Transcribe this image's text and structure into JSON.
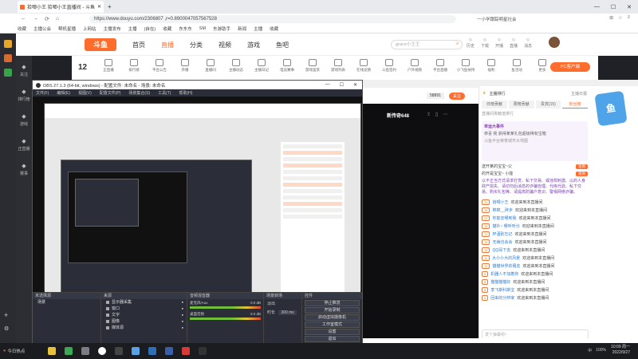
{
  "browser": {
    "tab_title": "拾唧小王 拾唧小王直播间 - 斗鱼",
    "url": "https://www.douyu.com/2306807 ,r=0.8900047057567528",
    "address_right_label": "一小学跟踪明星社会",
    "bookmarks": [
      "收藏",
      "主播公会",
      "帮机星播",
      "上网站",
      "主播发布",
      "主播",
      "(自在)",
      "收藏",
      "东东东",
      "SM",
      "东游助手",
      "新闻",
      "主播",
      "收藏"
    ]
  },
  "leftnav": {
    "items": [
      {
        "label": "关注",
        "icon": "heart-icon"
      },
      {
        "label": "排行榜",
        "icon": "rank-icon"
      },
      {
        "label": "游戏",
        "icon": "game-icon"
      },
      {
        "label": "正直播",
        "icon": "live-icon"
      },
      {
        "label": "赛事",
        "icon": "trophy-icon"
      }
    ]
  },
  "douyu": {
    "logo": "斗鱼",
    "nav": [
      "首页",
      "直播",
      "分类",
      "视频",
      "游戏",
      "鱼吧"
    ],
    "nav_active": "直播",
    "search_placeholder": "grace小王王",
    "top_icons": [
      "历史",
      "下载",
      "开播",
      "直播",
      "消息"
    ]
  },
  "categories": {
    "count": "12",
    "items": [
      "正直播",
      "排行榜",
      "平台公告",
      "开播",
      "直播间",
      "主播动态",
      "主播日记",
      "电竞赛事",
      "游戏鉴赏",
      "游戏列表",
      "在线竞猜",
      "斗鱼签约",
      "户外视频",
      "平台直播",
      "小飞鱼扶持",
      "福利",
      "鱼活动",
      "更多"
    ],
    "pc_button": "PC客户端"
  },
  "stream": {
    "banner": "新传奇648",
    "follow_count": "58891",
    "follow_button": "关注"
  },
  "chat": {
    "host_label": "主播排行",
    "host_right": "主播日报",
    "tabs": [
      "日榜贡献",
      "周榜贡献",
      "贵宾(15)",
      "粉丝榜"
    ],
    "active_tab": "粉丝榜",
    "rank_note": "直播间贡献值排行",
    "sys_title": "幸运大事件",
    "sys_line": "恭喜 我 获得某某礼包超级稀有宝箱",
    "sys_sub": "斗鱼平台荣誉城市大地图",
    "fans": [
      {
        "name": "送开某的宝宝~父",
        "badge": "签到"
      },
      {
        "name": "的开是宝宝~ 小能",
        "badge": "签到"
      }
    ],
    "warning": "以不正当方式请求打赏、私下交易、或违规刺激、以的人身财产损失、请切勿后消息的诈骗自理、代练代验、私下交易、购买礼包等、请提高防骗户意识、警惕网络诈骗。",
    "messages": [
      {
        "lv": "31",
        "name": "拾唧小王",
        "text": "欢迎来到本直播间"
      },
      {
        "lv": "26",
        "name": "棉棉__碎步",
        "text": "欢迎来到本直播间"
      },
      {
        "lv": "22",
        "name": "你能去哪到我",
        "text": "欢迎来到本直播间"
      },
      {
        "lv": "18",
        "name": "猫扑~ 哪听听分",
        "text": "欢迎来到本直播间"
      },
      {
        "lv": "17",
        "name": "杯酒别忘记",
        "text": "欢迎来到本直播间"
      },
      {
        "lv": "15",
        "name": "无病也会会",
        "text": "欢迎来到本直播间"
      },
      {
        "lv": "12",
        "name": "QQ哥下去",
        "text": "欢迎来到本直播间"
      },
      {
        "lv": "11",
        "name": "大小小大的风景",
        "text": "欢迎来到本直播间"
      },
      {
        "lv": "10",
        "name": "猫猫世界的朋友",
        "text": "欢迎来到本直播间"
      },
      {
        "lv": "9",
        "name": "机器人不加着你",
        "text": "欢迎来到本直播间"
      },
      {
        "lv": "8",
        "name": "猫猫猫猫好",
        "text": "欢迎来到本直播间"
      },
      {
        "lv": "6",
        "name": "李飞斯科斯宝",
        "text": "欢迎来到本直播间"
      },
      {
        "lv": "5",
        "name": "回来的分辨家",
        "text": "欢迎来到本直播间"
      }
    ],
    "input_placeholder": "发个弹幕呗~"
  },
  "obs": {
    "title": "OBS 27.1.3 (64-bit, windows) - 配置文件: 未命名 - 场景: 未命名",
    "menu": [
      "文件(F)",
      "编辑(E)",
      "视图(V)",
      "配置文件(P)",
      "场景集合(S)",
      "工具(T)",
      "帮助(H)"
    ],
    "docks": {
      "scenes": "场景",
      "sources": "来源",
      "mixer": "音频混音器",
      "transitions": "场景转场",
      "controls": "控件"
    },
    "scenes_header": "未选择源",
    "sources": [
      "显示器采集",
      "窗口",
      "文字",
      "图像",
      "媒体源"
    ],
    "mixer": [
      {
        "name": "麦克风/Aux",
        "level": "0.0 dB"
      },
      {
        "name": "桌面音频",
        "level": "0.0 dB"
      }
    ],
    "transition": {
      "type": "淡出",
      "duration_label": "时长",
      "duration": "300 ms"
    },
    "controls": [
      "停止推流",
      "开始录制",
      "启动虚拟摄像机",
      "工作室模式",
      "设置",
      "退出"
    ]
  },
  "taskbar": {
    "start_label": "今日热点",
    "time": "10:09 周一",
    "date": "2022/9/27",
    "tray": [
      "中",
      "100%"
    ]
  },
  "colors": {
    "brand": "#ff6d2d",
    "obs_bg": "#2b2e38"
  }
}
